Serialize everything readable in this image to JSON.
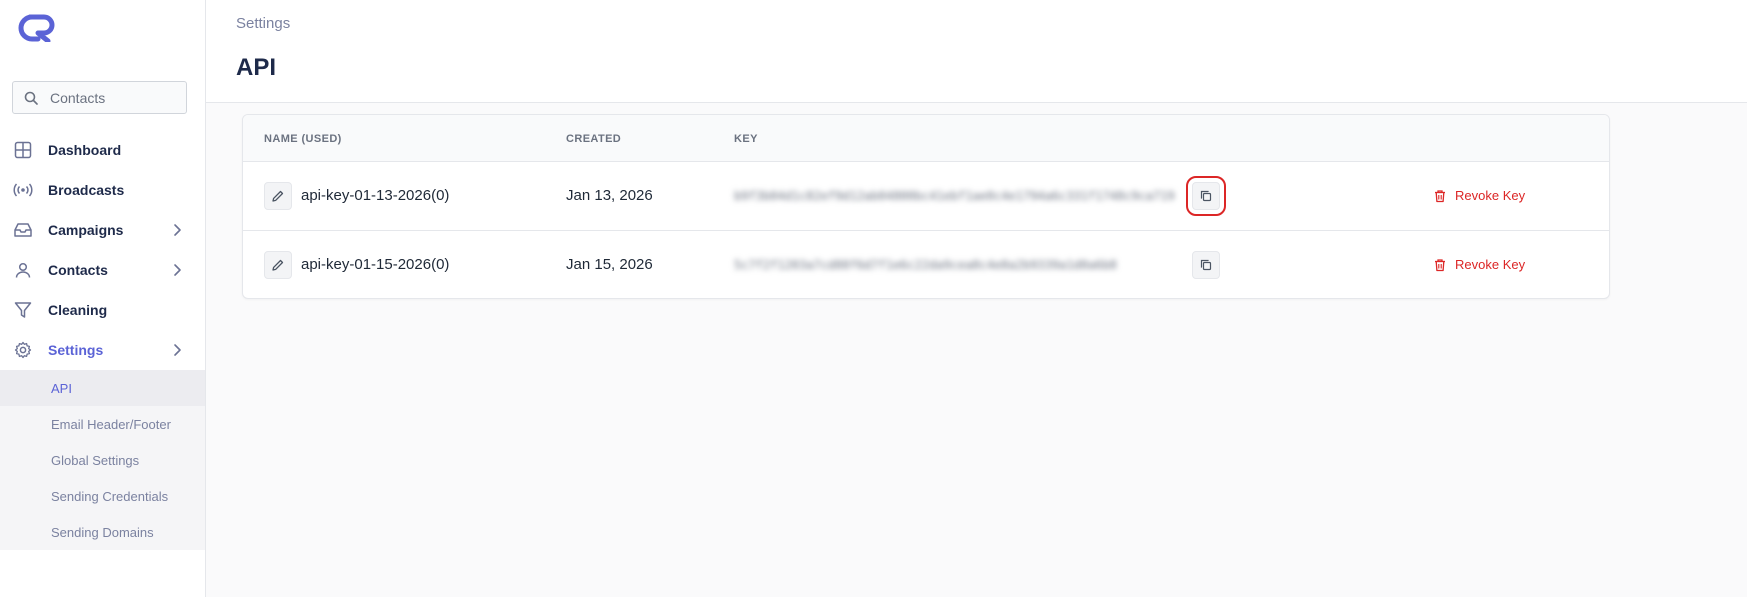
{
  "brand": {
    "accent": "#5b63d6",
    "logo_color": "#5b63d6"
  },
  "search": {
    "placeholder": "Contacts"
  },
  "sidebar": {
    "items": [
      {
        "label": "Dashboard",
        "icon": "grid-icon"
      },
      {
        "label": "Broadcasts",
        "icon": "broadcast-icon"
      },
      {
        "label": "Campaigns",
        "icon": "inbox-icon",
        "has_children": true
      },
      {
        "label": "Contacts",
        "icon": "user-icon",
        "has_children": true
      },
      {
        "label": "Cleaning",
        "icon": "filter-icon"
      },
      {
        "label": "Settings",
        "icon": "gear-icon",
        "has_children": true,
        "active": true
      }
    ],
    "subitems": [
      {
        "label": "API",
        "active": true
      },
      {
        "label": "Email Header/Footer"
      },
      {
        "label": "Global Settings"
      },
      {
        "label": "Sending Credentials"
      },
      {
        "label": "Sending Domains"
      }
    ]
  },
  "header": {
    "breadcrumb": "Settings",
    "title": "API"
  },
  "table": {
    "columns": [
      "NAME (USED)",
      "CREATED",
      "KEY"
    ],
    "rows": [
      {
        "name": "api-key-01-13-2026(0)",
        "created": "Jan 13, 2026",
        "key": "b9f3b04d1c82ef9d12ab04800bc41ebf1ae0c4e1794a6c331f1748c9ca719",
        "revoke_label": "Revoke Key",
        "copy_highlighted": true
      },
      {
        "name": "api-key-01-15-2026(0)",
        "created": "Jan 15, 2026",
        "key": "5c7f2f1203a7cd88f6d7f1e6c22da9cea8c4e8a2b9339a1d0a6b8",
        "revoke_label": "Revoke Key",
        "copy_highlighted": false
      }
    ]
  }
}
